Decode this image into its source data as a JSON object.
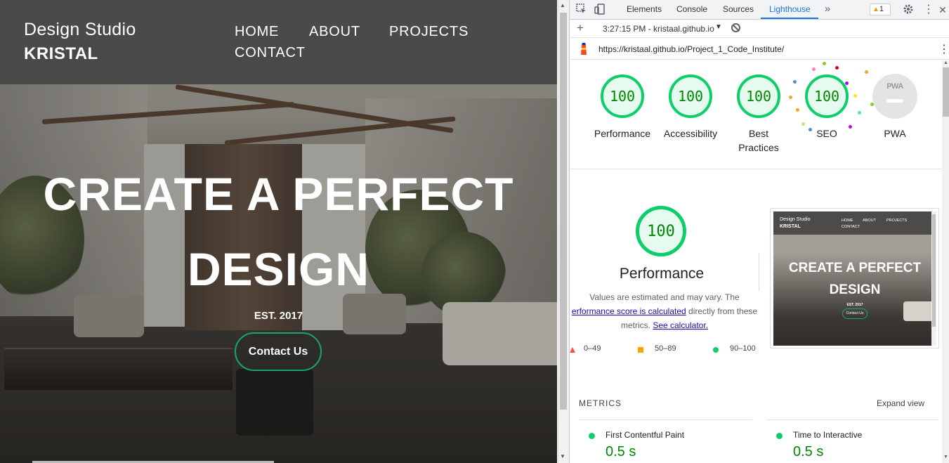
{
  "site": {
    "brand_line1": "Design Studio",
    "brand_line2": "KRISTAL",
    "nav": [
      "HOME",
      "ABOUT",
      "PROJECTS",
      "CONTACT"
    ],
    "hero_line1": "CREATE A PERFECT",
    "hero_line2": "DESIGN",
    "est": "EST. 2017",
    "cta": "Contact Us",
    "cta_border_color": "#17a66a"
  },
  "devtools": {
    "tabs": [
      "Elements",
      "Console",
      "Sources",
      "Lighthouse"
    ],
    "active_tab": "Lighthouse",
    "more_tabs_icon": "double-chevron-right-icon",
    "warning_count": "1",
    "report_label": "3:27:15 PM - kristaal.github.io",
    "url": "https://kristaal.github.io/Project_1_Code_Institute/"
  },
  "lighthouse": {
    "categories": [
      {
        "label": "Performance",
        "score": "100"
      },
      {
        "label": "Accessibility",
        "score": "100"
      },
      {
        "label": "Best Practices",
        "score": "100"
      },
      {
        "label": "SEO",
        "score": "100"
      },
      {
        "label": "PWA",
        "score": "PWA"
      }
    ],
    "performance": {
      "score": "100",
      "title": "Performance",
      "desc_text1": "Values are estimated and may vary. The",
      "desc_link1": "erformance score is calculated",
      "desc_text2": "directly from these",
      "desc_text3": "metrics.",
      "desc_link2": "See calculator."
    },
    "legend": [
      {
        "range": "0–49",
        "color": "#ff4e42",
        "shape": "triangle"
      },
      {
        "range": "50–89",
        "color": "#ffa400",
        "shape": "square"
      },
      {
        "range": "90–100",
        "color": "#0cce6b",
        "shape": "circle"
      }
    ],
    "thumbnail": {
      "brand_line1": "Design Studio",
      "brand_line2": "KRISTAL",
      "nav": [
        "HOME",
        "ABOUT",
        "PROJECTS",
        "CONTACT"
      ],
      "hero_line1": "CREATE A PERFECT",
      "hero_line2": "DESIGN",
      "est": "EST. 2017",
      "cta": "Contact Us"
    },
    "metrics_title": "METRICS",
    "expand_view": "Expand view",
    "metrics": [
      {
        "name": "First Contentful Paint",
        "value": "0.5 s"
      },
      {
        "name": "Time to Interactive",
        "value": "0.5 s"
      }
    ],
    "pass_color": "#0cce6b"
  }
}
